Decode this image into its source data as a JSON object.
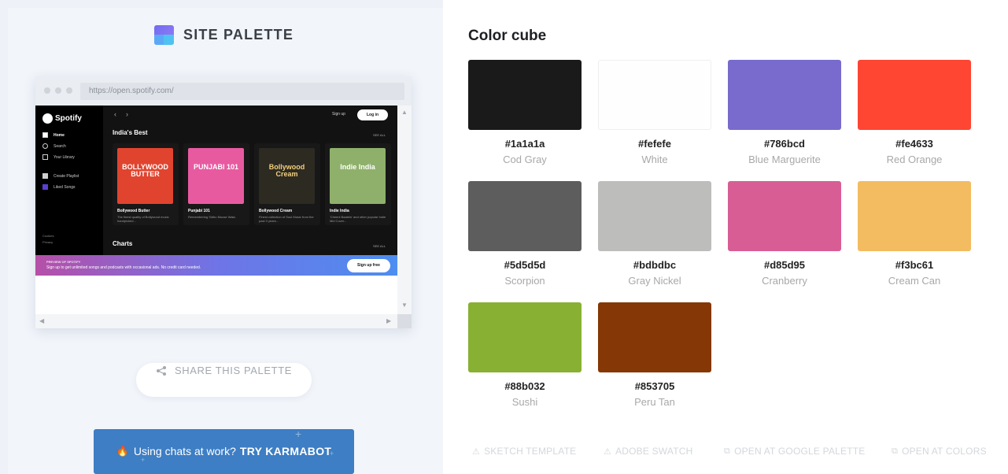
{
  "brand": {
    "name": "SITE PALETTE"
  },
  "browser": {
    "url": "https://open.spotify.com/"
  },
  "spotify": {
    "logo": "Spotify",
    "nav": [
      "Home",
      "Search",
      "Your Library"
    ],
    "nav2": [
      "Create Playlist",
      "Liked Songs"
    ],
    "footer": [
      "Cookies",
      "Privacy"
    ],
    "signup": "Sign up",
    "login": "Log in",
    "section1": "India's Best",
    "section2": "Charts",
    "see_all": "SEE ALL",
    "cards": [
      {
        "art": "BOLLYWOOD BUTTER",
        "title": "Bollywood Butter",
        "desc": "The finest quality of Bollywood music handpicked...",
        "bg": "#e0442f"
      },
      {
        "art": "PUNJABI 101",
        "title": "Punjabi 101",
        "desc": "Remembering Sidhu Moose Wala.",
        "bg": "#e85aa0"
      },
      {
        "art": "Bollywood Cream",
        "title": "Bollywood Cream",
        "desc": "Finest collection of Soul Music from the past 3 years...",
        "bg": "#2d2a22"
      },
      {
        "art": "Indie India",
        "title": "Indie India",
        "desc": "'Cheeni Baatein' and other popular Indie Mid Cover...",
        "bg": "#8fb06b"
      }
    ],
    "banner_title": "PREVIEW OF SPOTIFY",
    "banner_text": "Sign up to get unlimited songs and podcasts with occasional ads. No credit card needed.",
    "banner_button": "Sign up free"
  },
  "share": {
    "label": "SHARE THIS PALETTE",
    "icon": "share-icon"
  },
  "promo": {
    "text": "Using chats at work?",
    "cta": "TRY KARMABOT",
    "icon": "fire-icon"
  },
  "palette": {
    "title": "Color cube",
    "colors": [
      {
        "hex": "#1a1a1a",
        "name": "Cod Gray"
      },
      {
        "hex": "#fefefe",
        "name": "White"
      },
      {
        "hex": "#786bcd",
        "name": "Blue Marguerite"
      },
      {
        "hex": "#fe4633",
        "name": "Red Orange"
      },
      {
        "hex": "#5d5d5d",
        "name": "Scorpion"
      },
      {
        "hex": "#bdbdbc",
        "name": "Gray Nickel"
      },
      {
        "hex": "#d85d95",
        "name": "Cranberry"
      },
      {
        "hex": "#f3bc61",
        "name": "Cream Can"
      },
      {
        "hex": "#88b032",
        "name": "Sushi"
      },
      {
        "hex": "#853705",
        "name": "Peru Tan"
      }
    ]
  },
  "links": [
    {
      "label": "SKETCH TEMPLATE",
      "icon": "sketch-icon"
    },
    {
      "label": "ADOBE SWATCH",
      "icon": "adobe-icon"
    },
    {
      "label": "OPEN AT GOOGLE PALETTE",
      "icon": "external-link-icon"
    },
    {
      "label": "OPEN AT COLORS",
      "icon": "external-link-icon"
    }
  ]
}
